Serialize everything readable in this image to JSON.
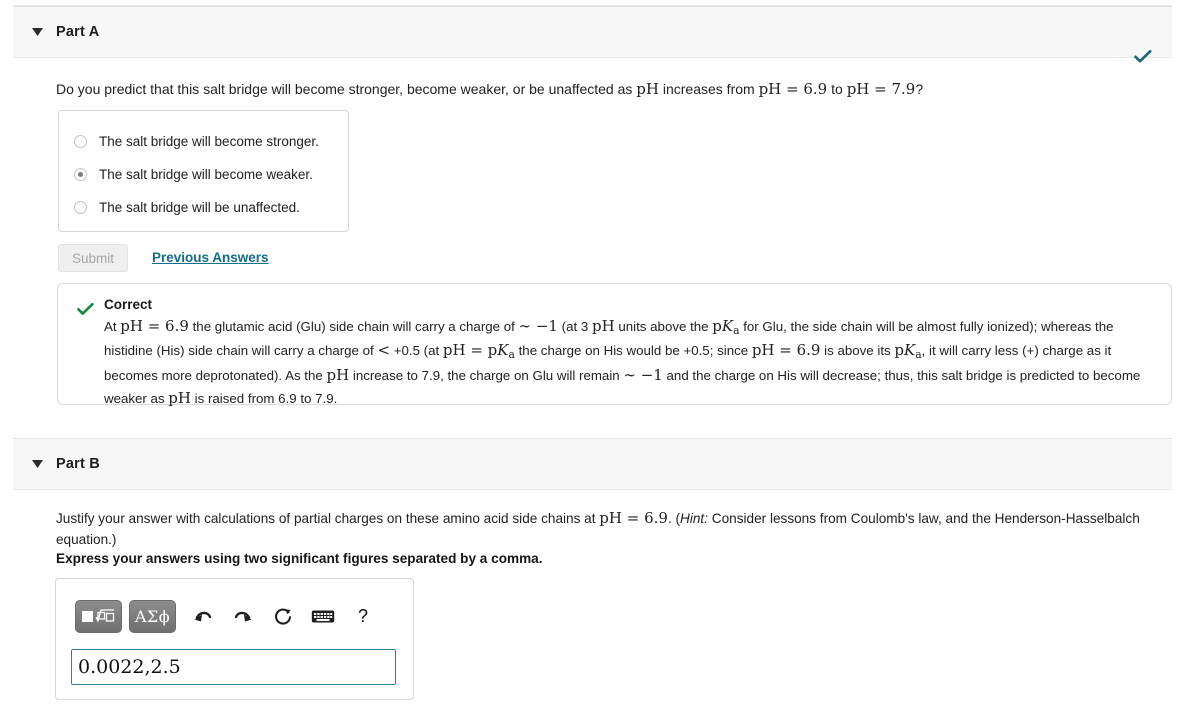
{
  "parts": {
    "a": {
      "title": "Part A",
      "caret_icon": "caret-down-icon",
      "status_icon": "check-icon",
      "question_pre": "Do you predict that this salt bridge will become stronger, become weaker, or be unaffected as ",
      "question_ph1": "pH",
      "question_mid": " increases from ",
      "question_ph2": "pH = 6.9",
      "question_to": " to ",
      "question_ph3": "pH = 7.9",
      "question_end": "?",
      "choices": [
        {
          "label": "The salt bridge will become stronger.",
          "selected": false
        },
        {
          "label": "The salt bridge will become weaker.",
          "selected": true
        },
        {
          "label": "The salt bridge will be unaffected.",
          "selected": false
        }
      ],
      "submit_label": "Submit",
      "previous_answers_label": "Previous Answers",
      "feedback": {
        "icon": "check-icon",
        "title": "Correct",
        "t1": "At ",
        "m1": "pH = 6.9",
        "t2": " the glutamic acid (Glu) side chain will carry a charge of ",
        "m2": "∼ −1",
        "t3": " (at 3 ",
        "m3": "pH",
        "t4": " units above the ",
        "m4_p": "p",
        "m4_k": "K",
        "m4_a": "a",
        "t5": " for Glu, the side chain will be almost fully ionized); whereas the histidine (His) side chain will carry a charge of ",
        "m5": "<",
        "t6": " +0.5 (at ",
        "m6": "pH = p",
        "m6_k": "K",
        "m6_a": "a",
        "t7": " the charge on His would be +0.5; since ",
        "m7": "pH = 6.9",
        "t8": " is above its ",
        "m8_p": "p",
        "m8_k": "K",
        "m8_a": "a",
        "t9": ", it will carry less (+) charge as it becomes more deprotonated). As the ",
        "m9": "pH",
        "t10": " increase to 7.9, the charge on Glu will remain ",
        "m10": "∼ −1",
        "t11": " and the charge on His will decrease; thus, this salt bridge is predicted to become weaker as ",
        "m11": "pH",
        "t12": " is raised from 6.9 to 7.9."
      }
    },
    "b": {
      "title": "Part B",
      "caret_icon": "caret-down-icon",
      "q_pre": "Justify your answer with calculations of partial charges on these amino acid side chains at ",
      "q_math": "pH = 6.9",
      "q_mid": ". (",
      "q_hint": "Hint:",
      "q_post": " Consider lessons from Coulomb's law, and the Henderson-Hasselbalch equation.)",
      "express_label": "Express your answers using two significant figures separated by a comma.",
      "toolbar": {
        "template_button": "math-template-button",
        "greek_button": "ΑΣϕ",
        "undo_icon": "undo-arrow-icon",
        "redo_icon": "redo-arrow-icon",
        "reset_icon": "reset-circular-arrow-icon",
        "keyboard_icon": "keyboard-icon",
        "help_label": "?"
      },
      "answer_value": "0.0022,2.5",
      "answer_placeholder": ""
    }
  },
  "colors": {
    "link": "#156e88",
    "correct_green": "#138a3e",
    "status_teal": "#16667a",
    "input_border": "#2f8296",
    "header_bg": "#f7f7f7"
  }
}
